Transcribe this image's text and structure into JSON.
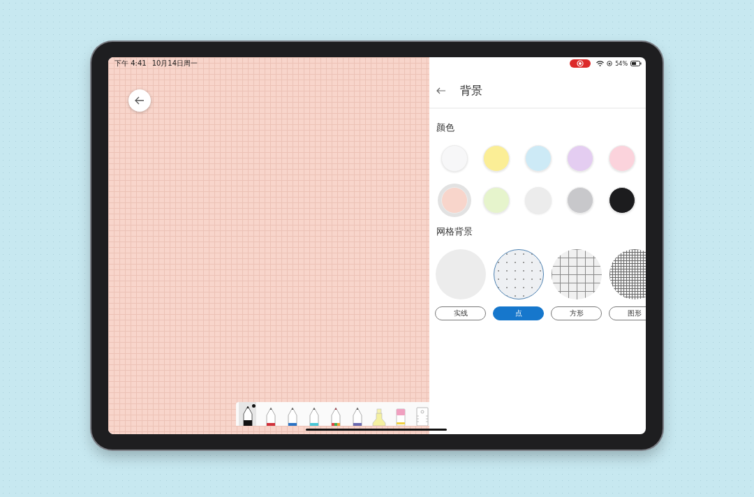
{
  "status_bar": {
    "time": "下午 4:41",
    "date": "10月14日周一",
    "recording": true,
    "battery": "54%"
  },
  "panel": {
    "title": "背景",
    "color_section": {
      "title": "颜色",
      "colors": [
        {
          "color": "#f7f7f8",
          "selected": false
        },
        {
          "color": "#fbee96",
          "selected": false
        },
        {
          "color": "#cdeaf6",
          "selected": false
        },
        {
          "color": "#e4cdf1",
          "selected": false
        },
        {
          "color": "#fbd3dc",
          "selected": false
        },
        {
          "color": "#f8d5cb",
          "selected": true
        },
        {
          "color": "#e6f4cc",
          "selected": false
        },
        {
          "color": "#ececec",
          "selected": false
        },
        {
          "color": "#c8c8cb",
          "selected": false
        },
        {
          "color": "#1c1c1e",
          "selected": false
        }
      ]
    },
    "grid_section": {
      "title": "网格背景",
      "options": [
        {
          "kind": "solid",
          "label": "实线",
          "selected": false
        },
        {
          "kind": "dot",
          "label": "点",
          "selected": true
        },
        {
          "kind": "square",
          "label": "方形",
          "selected": false
        },
        {
          "kind": "graph",
          "label": "图形",
          "selected": false
        }
      ]
    }
  },
  "tools": [
    {
      "kind": "pencil",
      "color": "#111111",
      "selected": true
    },
    {
      "kind": "pen",
      "color": "#d0303a",
      "selected": false
    },
    {
      "kind": "pen",
      "color": "#2a72c4",
      "selected": false
    },
    {
      "kind": "pen",
      "color": "#48c6d6",
      "selected": false
    },
    {
      "kind": "rainbow-pen",
      "selected": false
    },
    {
      "kind": "pen",
      "color": "#6a6ab0",
      "selected": false
    },
    {
      "kind": "highlighter",
      "color": "#f4f0a0",
      "selected": false
    },
    {
      "kind": "eraser",
      "color": "#f0a0c0",
      "selected": false
    },
    {
      "kind": "ruler",
      "selected": false
    }
  ]
}
